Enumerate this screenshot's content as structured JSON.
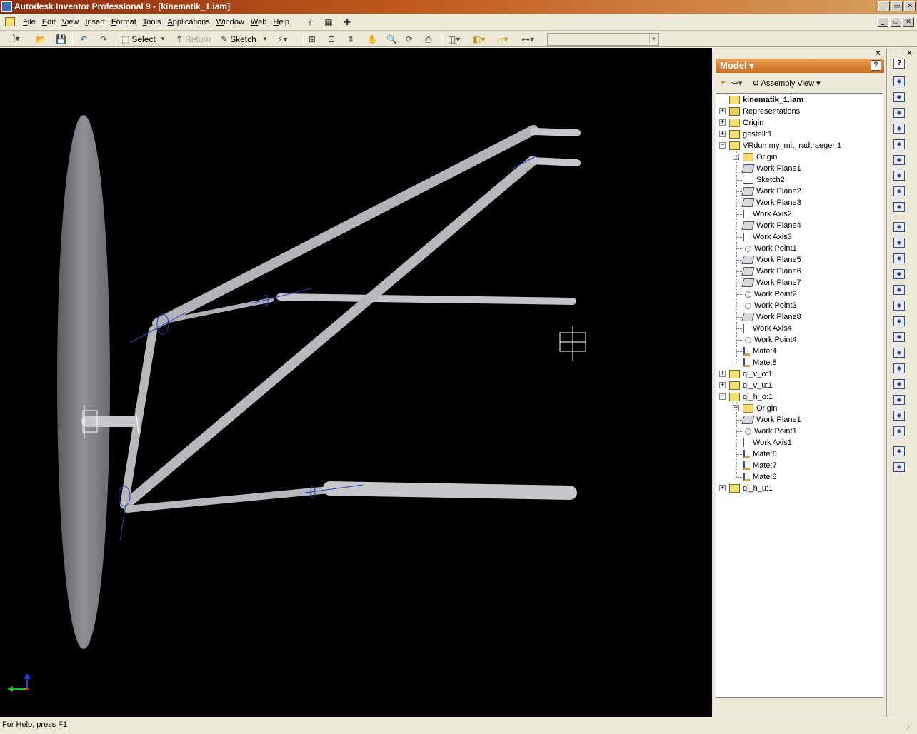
{
  "window": {
    "title": "Autodesk Inventor Professional 9 - [kinematik_1.iam]",
    "controls": [
      "_",
      "▭",
      "✕"
    ]
  },
  "menubar": {
    "items": [
      {
        "label": "File",
        "hot": "F",
        "rest": "ile"
      },
      {
        "label": "Edit",
        "hot": "E",
        "rest": "dit"
      },
      {
        "label": "View",
        "hot": "V",
        "rest": "iew"
      },
      {
        "label": "Insert",
        "hot": "I",
        "rest": "nsert"
      },
      {
        "label": "Format",
        "hot": "F",
        "rest": "ormat",
        "pre": "F",
        "alt": true
      },
      {
        "label": "Tools",
        "hot": "T",
        "rest": "ools"
      },
      {
        "label": "Applications",
        "hot": "A",
        "rest": "pplications"
      },
      {
        "label": "Window",
        "hot": "W",
        "rest": "indow"
      },
      {
        "label": "Web",
        "hot": "W",
        "rest": "eb"
      },
      {
        "label": "Help",
        "hot": "H",
        "rest": "elp"
      }
    ],
    "extra_icons": [
      "help-icon",
      "calculator-icon",
      "add-icon"
    ]
  },
  "toolbar": {
    "select_label": "Select",
    "return_label": "Return",
    "sketch_label": "Sketch",
    "combo_value": ""
  },
  "browser": {
    "header": "Model",
    "view_mode": "Assembly View",
    "help": "?",
    "tree": [
      {
        "label": "kinematik_1.iam",
        "icon": "assembly",
        "level": 0,
        "expander": "",
        "bold": true
      },
      {
        "label": "Representations",
        "icon": "representations",
        "level": 0,
        "expander": "+"
      },
      {
        "label": "Origin",
        "icon": "folder",
        "level": 0,
        "expander": "+"
      },
      {
        "label": "gestell:1",
        "icon": "part",
        "level": 0,
        "expander": "+"
      },
      {
        "label": "VRdummy_mit_radtraeger:1",
        "icon": "part",
        "level": 0,
        "expander": "−"
      },
      {
        "label": "Origin",
        "icon": "folder",
        "level": 1,
        "expander": "+"
      },
      {
        "label": "Work Plane1",
        "icon": "plane",
        "level": 1,
        "expander": ""
      },
      {
        "label": "Sketch2",
        "icon": "sketch",
        "level": 1,
        "expander": ""
      },
      {
        "label": "Work Plane2",
        "icon": "plane",
        "level": 1,
        "expander": ""
      },
      {
        "label": "Work Plane3",
        "icon": "plane",
        "level": 1,
        "expander": ""
      },
      {
        "label": "Work Axis2",
        "icon": "axis",
        "level": 1,
        "expander": ""
      },
      {
        "label": "Work Plane4",
        "icon": "plane",
        "level": 1,
        "expander": ""
      },
      {
        "label": "Work Axis3",
        "icon": "axis",
        "level": 1,
        "expander": ""
      },
      {
        "label": "Work Point1",
        "icon": "point",
        "level": 1,
        "expander": ""
      },
      {
        "label": "Work Plane5",
        "icon": "plane",
        "level": 1,
        "expander": ""
      },
      {
        "label": "Work Plane6",
        "icon": "plane",
        "level": 1,
        "expander": ""
      },
      {
        "label": "Work Plane7",
        "icon": "plane",
        "level": 1,
        "expander": ""
      },
      {
        "label": "Work Point2",
        "icon": "point",
        "level": 1,
        "expander": ""
      },
      {
        "label": "Work Point3",
        "icon": "point",
        "level": 1,
        "expander": ""
      },
      {
        "label": "Work Plane8",
        "icon": "plane",
        "level": 1,
        "expander": ""
      },
      {
        "label": "Work Axis4",
        "icon": "axis",
        "level": 1,
        "expander": ""
      },
      {
        "label": "Work Point4",
        "icon": "point",
        "level": 1,
        "expander": ""
      },
      {
        "label": "Mate:4",
        "icon": "mate",
        "level": 1,
        "expander": ""
      },
      {
        "label": "Mate:8",
        "icon": "mate",
        "level": 1,
        "expander": ""
      },
      {
        "label": "ql_v_o:1",
        "icon": "part",
        "level": 0,
        "expander": "+"
      },
      {
        "label": "ql_v_u:1",
        "icon": "part",
        "level": 0,
        "expander": "+"
      },
      {
        "label": "ql_h_o:1",
        "icon": "part",
        "level": 0,
        "expander": "−"
      },
      {
        "label": "Origin",
        "icon": "folder",
        "level": 1,
        "expander": "+"
      },
      {
        "label": "Work Plane1",
        "icon": "plane",
        "level": 1,
        "expander": ""
      },
      {
        "label": "Work Point1",
        "icon": "point",
        "level": 1,
        "expander": ""
      },
      {
        "label": "Work Axis1",
        "icon": "axis",
        "level": 1,
        "expander": ""
      },
      {
        "label": "Mate:6",
        "icon": "mate",
        "level": 1,
        "expander": ""
      },
      {
        "label": "Mate:7",
        "icon": "mate",
        "level": 1,
        "expander": ""
      },
      {
        "label": "Mate:8",
        "icon": "mate",
        "level": 1,
        "expander": ""
      },
      {
        "label": "ql_h_u:1",
        "icon": "part",
        "level": 0,
        "expander": "+"
      }
    ]
  },
  "panel_bar_icons": [
    "place-component-icon",
    "create-component-icon",
    "pattern-icon",
    "constraint-icon",
    "place-constraint-icon",
    "replace-icon",
    "move-icon",
    "rotate-icon",
    "section-icon",
    "weld-icon",
    "split-icon",
    "chamfer-icon",
    "fillet-icon",
    "hole-icon",
    "extrude-icon",
    "workplane-icon",
    "workaxis-icon",
    "workpoint-icon",
    "ucs-icon",
    "derive-icon",
    "shell-icon",
    "thread-icon",
    "surface-icon",
    "parameters-icon",
    "appearance-icon"
  ],
  "status": {
    "text": "For Help, press F1"
  },
  "colors": {
    "title_start": "#8e2c0d",
    "title_end": "#d8a060",
    "browser_header": "#d27a2c",
    "viewport_bg": "#000000"
  }
}
